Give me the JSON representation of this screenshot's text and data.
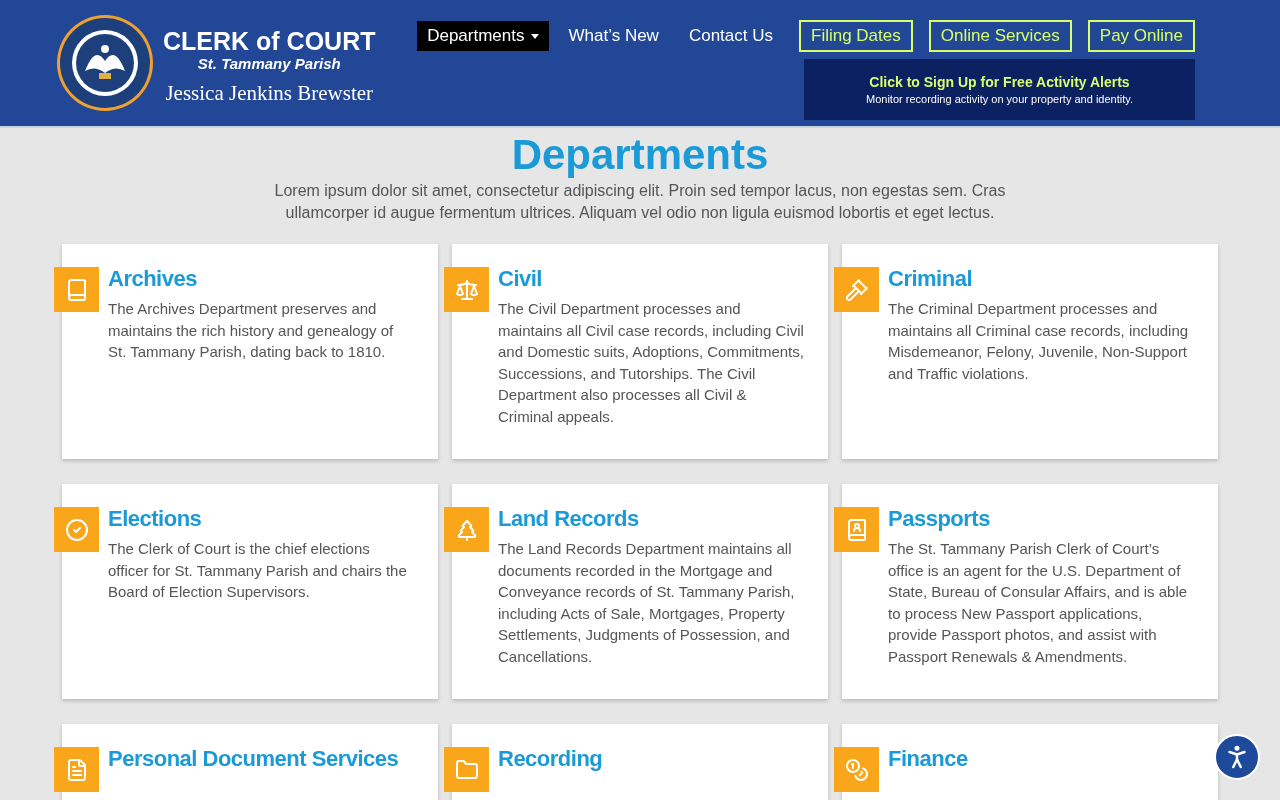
{
  "logo": {
    "title": "CLERK of COURT",
    "subtitle": "St. Tammany Parish",
    "signature": "Jessica Jenkins Brewster"
  },
  "nav": [
    {
      "label": "Departments",
      "kind": "dropdown",
      "selected": true
    },
    {
      "label": "What’s New",
      "kind": "link",
      "selected": false
    },
    {
      "label": "Contact Us",
      "kind": "link",
      "selected": false
    },
    {
      "label": "Filing Dates",
      "kind": "outlined",
      "selected": false
    },
    {
      "label": "Online Services",
      "kind": "outlined",
      "selected": false
    },
    {
      "label": "Pay Online",
      "kind": "outlined",
      "selected": false
    }
  ],
  "alert_banner": {
    "title": "Click to Sign Up for Free Activity Alerts",
    "text": "Monitor recording activity on your property and identity."
  },
  "page_title": "Departments",
  "intro": "Lorem ipsum dolor sit amet, consectetur adipiscing elit. Proin sed tempor lacus, non egestas sem. Cras ullamcorper id augue fermentum ultrices. Aliquam vel odio non ligula euismod lobortis et eget lectus.",
  "departments": [
    {
      "title": "Archives",
      "text": "The Archives Department preserves and maintains the rich history and genealogy of St. Tammany Parish, dating back to 1810."
    },
    {
      "title": "Civil",
      "text": "The Civil Department processes and maintains all Civil case records, including Civil and Domestic suits,  Adoptions, Commitments, Successions, and Tutorships.  The Civil Department also processes all Civil & Criminal appeals."
    },
    {
      "title": "Criminal",
      "text": "The Criminal Department processes and maintains all Criminal case records, including Misdemeanor, Felony, Juvenile, Non-Support and Traffic violations."
    },
    {
      "title": "Elections",
      "text": "The Clerk of Court is the chief elections officer for St. Tammany Parish and chairs the Board of Election Supervisors."
    },
    {
      "title": "Land Records",
      "text": "The Land Records Department maintains all documents recorded in the Mortgage and Conveyance records of St. Tammany Parish, including Acts of Sale, Mortgages, Property Settlements, Judgments of Possession, and Cancellations."
    },
    {
      "title": "Passports",
      "text": "The St. Tammany Parish Clerk of Court’s office is an agent for the U.S. Department of State, Bureau of Consular Affairs, and is able to process New Passport applications, provide Passport photos, and assist with Passport Renewals & Amendments."
    },
    {
      "title": "Personal Document Services"
    },
    {
      "title": "Recording"
    },
    {
      "title": "Finance"
    }
  ]
}
